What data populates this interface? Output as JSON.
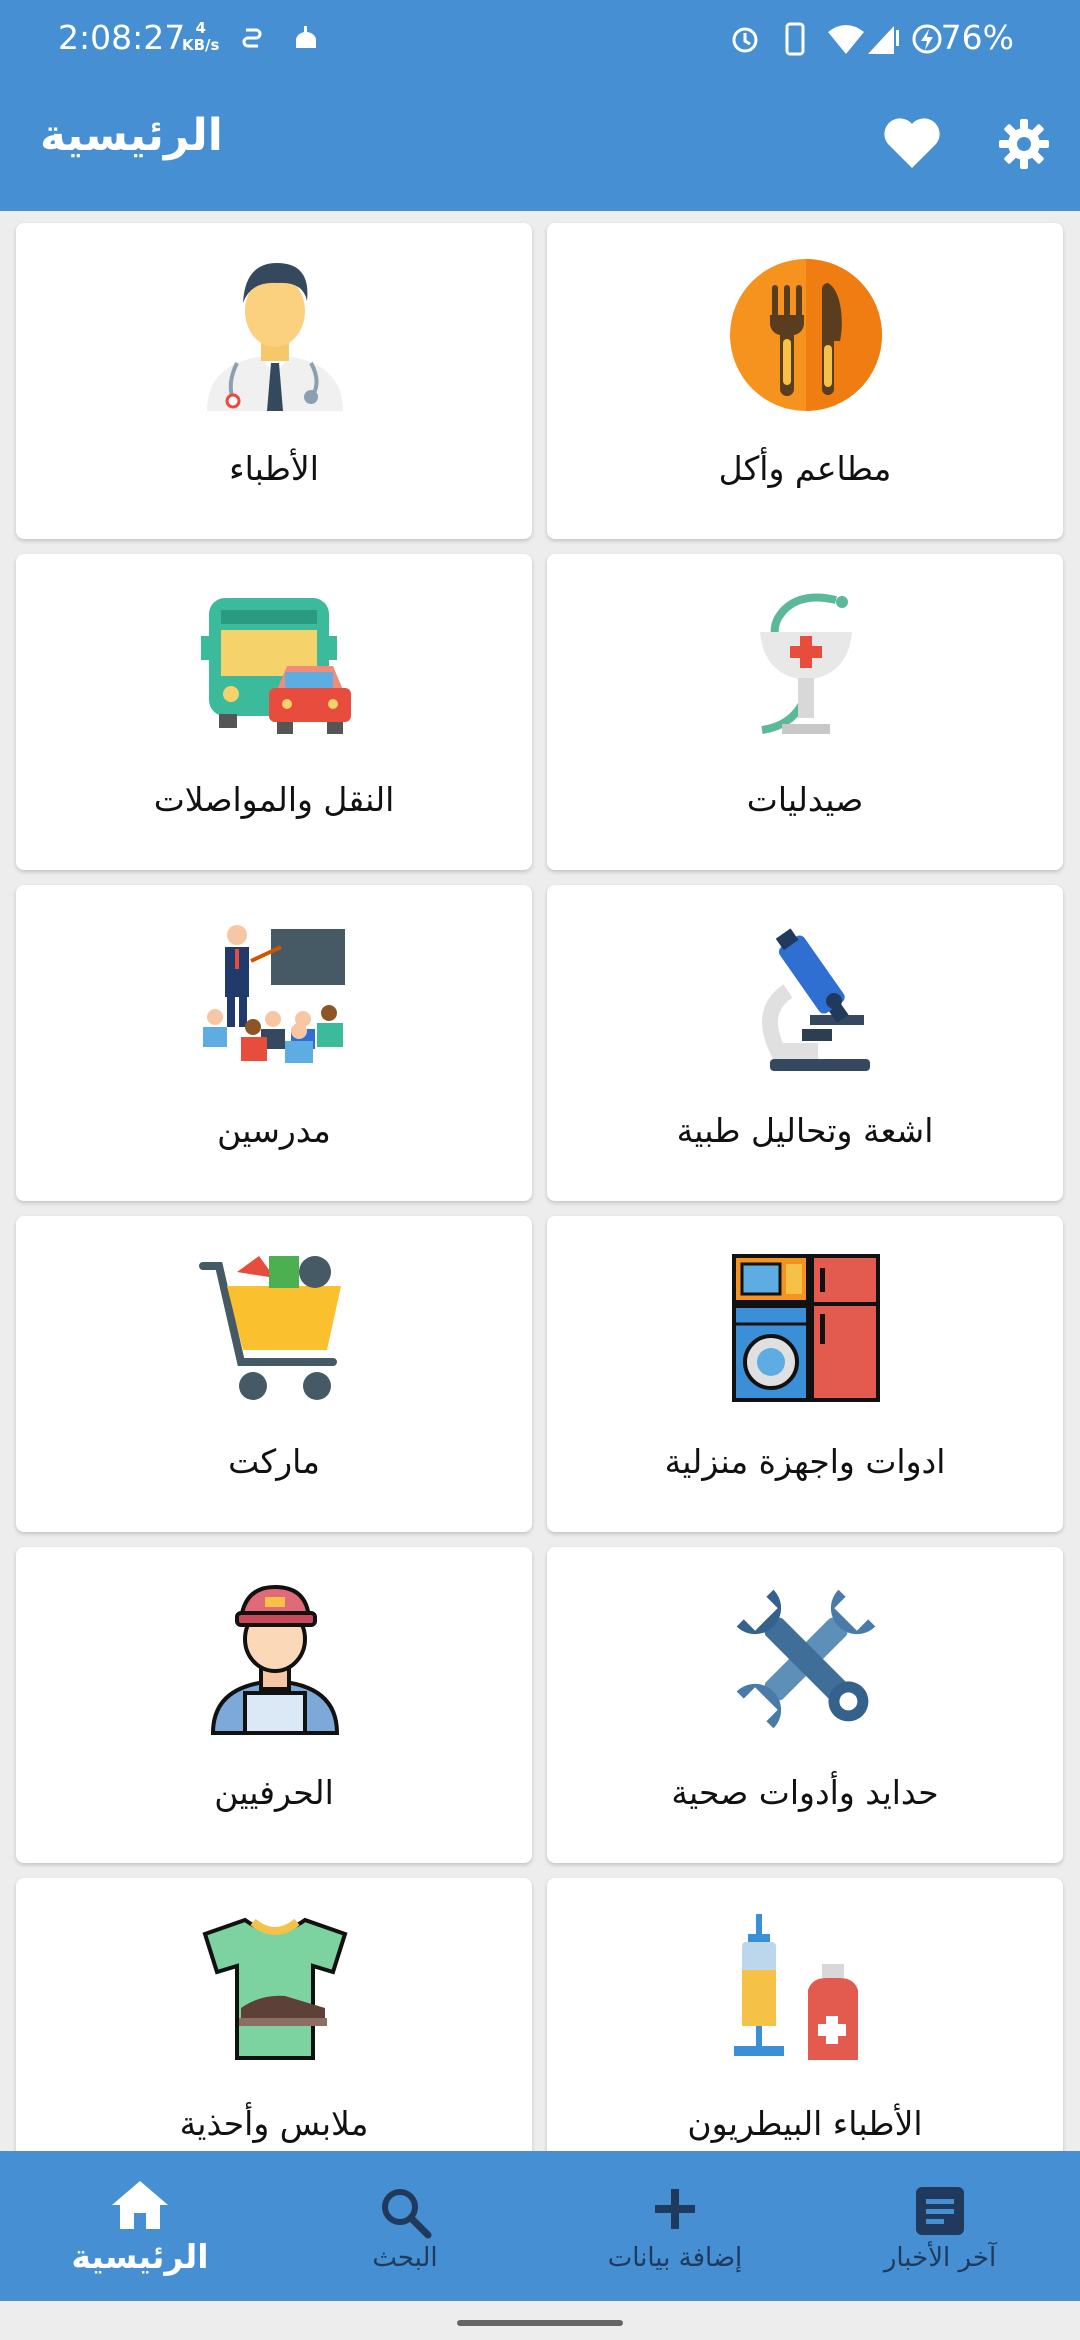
{
  "status_bar": {
    "time": "2:08:27",
    "net_speed_value": "4",
    "net_speed_unit": "KB/s",
    "battery": "76%"
  },
  "app_bar": {
    "title": "الرئيسية",
    "favorite_icon": "heart-icon",
    "settings_icon": "gear-icon"
  },
  "categories": [
    {
      "label": "مطاعم وأكل",
      "icon": "restaurant-icon"
    },
    {
      "label": "الأطباء",
      "icon": "doctor-icon"
    },
    {
      "label": "صيدليات",
      "icon": "pharmacy-icon"
    },
    {
      "label": "النقل والمواصلات",
      "icon": "transport-icon"
    },
    {
      "label": "اشعة وتحاليل طبية",
      "icon": "microscope-icon"
    },
    {
      "label": "مدرسين",
      "icon": "teacher-icon"
    },
    {
      "label": "ادوات واجهزة منزلية",
      "icon": "appliances-icon"
    },
    {
      "label": "ماركت",
      "icon": "cart-icon"
    },
    {
      "label": "حدايد وأدوات صحية",
      "icon": "tools-icon"
    },
    {
      "label": "الحرفيين",
      "icon": "craftsman-icon"
    },
    {
      "label": "الأطباء البيطريون",
      "icon": "veterinary-icon"
    },
    {
      "label": "ملابس وأحذية",
      "icon": "clothes-icon"
    }
  ],
  "bottom_nav": {
    "home": "الرئيسية",
    "search": "البحث",
    "add": "إضافة بيانات",
    "news": "آخر الأخبار",
    "active": "home"
  },
  "colors": {
    "primary": "#458fd2",
    "nav_inactive": "#1f3a5c"
  }
}
